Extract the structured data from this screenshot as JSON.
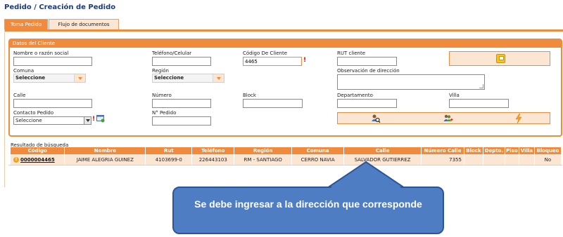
{
  "page": {
    "title": "Pedido / Creación de Pedido"
  },
  "tabs": [
    {
      "label": "Toma Pedido",
      "active": true
    },
    {
      "label": "Flujo de documentos",
      "active": false
    }
  ],
  "client": {
    "section_title": "Datos del Cliente",
    "fields": {
      "nombre_label": "Nombre o razón social",
      "nombre_value": "",
      "telefono_label": "Teléfono/Celular",
      "telefono_value": "",
      "codigo_label": "Código De Cliente",
      "codigo_value": "4465",
      "rut_label": "RUT cliente",
      "rut_value": "",
      "comuna_label": "Comuna",
      "comuna_value": "Seleccione",
      "region_label": "Región",
      "region_value": "Seleccione",
      "observacion_label": "Observación de dirección",
      "calle_label": "Calle",
      "numero_label": "Número",
      "block_label": "Block",
      "departamento_label": "Departamento",
      "villa_label": "Villa",
      "contacto_label": "Contacto Pedido",
      "contacto_value": "Seleccione",
      "npedido_label": "N° Pedido"
    },
    "required_mark": "!"
  },
  "results": {
    "label": "Resultado de búsqueda",
    "columns": [
      "Código",
      "Nombre",
      "Rut",
      "Teléfono",
      "Región",
      "Comuna",
      "Calle",
      "Número Calle",
      "Block",
      "Depto.",
      "Piso",
      "Villa",
      "Bloqueo"
    ],
    "rows": [
      {
        "codigo": "0000004465",
        "nombre": "JAIME ALEGRIA GUINEZ",
        "rut": "4103699-0",
        "telefono": "226443103",
        "region": "RM - SANTIAGO",
        "comuna": "CERRO NAVIA",
        "calle": "SALVADOR GUTIERREZ",
        "numero_calle": "7355",
        "block": "",
        "depto": "",
        "piso": "",
        "villa": "",
        "bloqueo": "No"
      }
    ]
  },
  "callout": {
    "text": "Se debe ingresar a la dirección que corresponde"
  },
  "icons": {
    "save": "save-icon",
    "search_client": "search-user-icon",
    "add_client": "add-users-icon",
    "lightning": "lightning-icon",
    "contact_add": "contact-add-icon",
    "row_info": "info-icon"
  },
  "colors": {
    "accent": "#f08a3c",
    "accent_light": "#fbe6d4",
    "title": "#1f3a78",
    "callout": "#4f7dc4"
  }
}
